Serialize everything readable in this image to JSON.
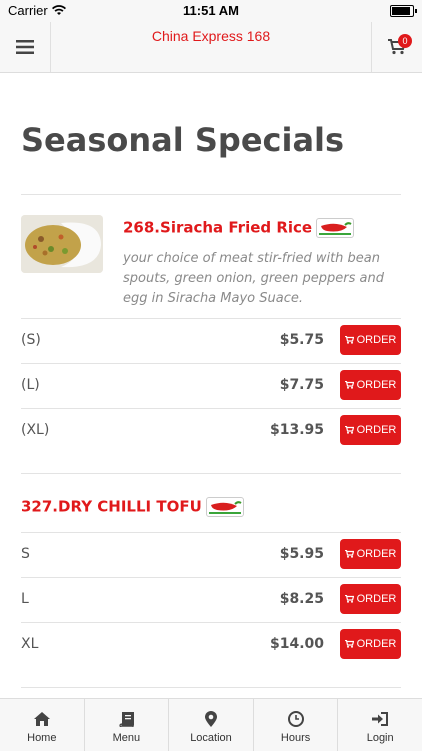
{
  "status_bar": {
    "carrier": "Carrier",
    "time": "11:51 AM",
    "battery_level": 0.9
  },
  "header": {
    "title": "China Express 168",
    "cart_count": "0"
  },
  "page": {
    "title": "Seasonal Specials"
  },
  "items": [
    {
      "name": "268.Siracha Fried Rice",
      "description": "your choice of meat stir-fried with bean spouts, green onion, green peppers and egg in Siracha Mayo Suace.",
      "spicy_icon": "chili-pepper-icon",
      "prices": [
        {
          "size": "(S)",
          "price": "$5.75",
          "order_label": "ORDER"
        },
        {
          "size": "(L)",
          "price": "$7.75",
          "order_label": "ORDER"
        },
        {
          "size": "(XL)",
          "price": "$13.95",
          "order_label": "ORDER"
        }
      ]
    },
    {
      "name": "327.DRY CHILLI TOFU",
      "spicy_icon": "chili-pepper-icon",
      "prices": [
        {
          "size": "S",
          "price": "$5.95",
          "order_label": "ORDER"
        },
        {
          "size": "L",
          "price": "$8.25",
          "order_label": "ORDER"
        },
        {
          "size": "XL",
          "price": "$14.00",
          "order_label": "ORDER"
        }
      ]
    }
  ],
  "tabs": [
    {
      "label": "Home",
      "icon": "home-icon"
    },
    {
      "label": "Menu",
      "icon": "book-icon"
    },
    {
      "label": "Location",
      "icon": "map-pin-icon"
    },
    {
      "label": "Hours",
      "icon": "clock-icon"
    },
    {
      "label": "Login",
      "icon": "login-icon"
    }
  ],
  "colors": {
    "accent": "#e0191b",
    "bar_bg": "#f7f7f7",
    "text_gray": "#555555"
  }
}
